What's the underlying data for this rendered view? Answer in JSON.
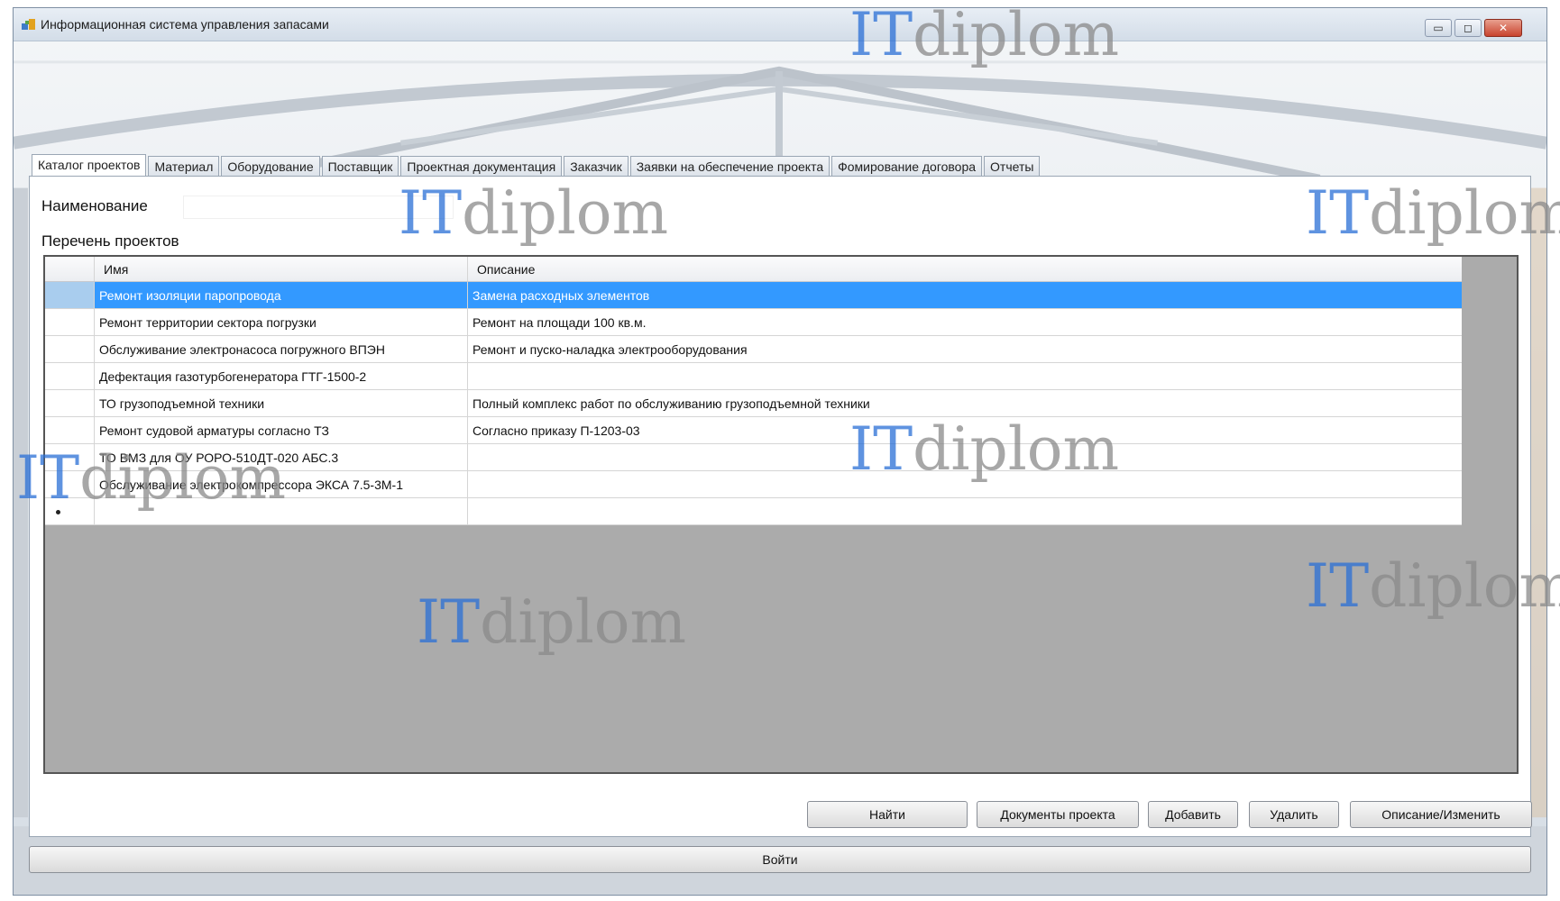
{
  "window": {
    "title": "Информационная система управления запасами",
    "controls": {
      "minimize": "▭",
      "maximize": "◻",
      "close": "✕"
    }
  },
  "tabs": [
    "Каталог проектов",
    "Материал",
    "Оборудование",
    "Поставщик",
    "Проектная документация",
    "Заказчик",
    "Заявки на обеспечение проекта",
    "Фомирование договора",
    "Отчеты"
  ],
  "active_tab_index": 0,
  "filter": {
    "label": "Наименование",
    "value": ""
  },
  "list_title": "Перечень проектов",
  "table": {
    "columns": [
      "Имя",
      "Описание"
    ],
    "selected_row_index": 0,
    "rows": [
      {
        "name": "Ремонт изоляции паропровода",
        "description": "Замена расходных элементов"
      },
      {
        "name": "Ремонт территории сектора погрузки",
        "description": "Ремонт на площади 100 кв.м."
      },
      {
        "name": "Обслуживание электронасоса погружного ВПЭН",
        "description": "Ремонт и пуско-наладка электрооборудования"
      },
      {
        "name": "Дефектация газотурбогенератора ГТГ-1500-2",
        "description": ""
      },
      {
        "name": "ТО грузоподъемной техники",
        "description": "Полный комплекс работ по обслуживанию грузоподъемной техники"
      },
      {
        "name": "Ремонт судовой арматуры согласно ТЗ",
        "description": "Согласно приказу П-1203-03"
      },
      {
        "name": "ТО ВМЗ для ОУ РОРО-510ДТ-020 АБС.3",
        "description": ""
      },
      {
        "name": "Обслуживание электрокомпрессора ЭКСА 7.5-3М-1",
        "description": ""
      }
    ]
  },
  "buttons": {
    "find": "Найти",
    "project_docs": "Документы проекта",
    "add": "Добавить",
    "delete": "Удалить",
    "describe_edit": "Описание/Изменить",
    "login": "Войти"
  },
  "watermark": {
    "it": "IT",
    "diplom": "diplom"
  },
  "colors": {
    "selection": "#3399ff",
    "grid_background": "#ababab",
    "watermark_it": "#2a6fd6"
  }
}
